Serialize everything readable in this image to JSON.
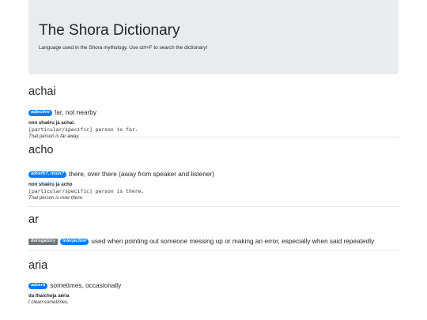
{
  "header": {
    "title": "The Shora Dictionary",
    "subtitle": "Language used in the Shora mythology. Use ctrl+F to search the dictionary!"
  },
  "entries": [
    {
      "word": "achai",
      "tags": [
        {
          "label": "adjective",
          "style": "blue"
        }
      ],
      "definition": "far, not nearby",
      "example": {
        "source": "non shaéru ja achai.",
        "gloss": "[particular/specific] person is far.",
        "translation": "That person is far away."
      }
    },
    {
      "word": "acho",
      "tags": [
        {
          "label": "adverb?, noun?",
          "style": "blue"
        }
      ],
      "definition": "there, over there (away from speaker and listener)",
      "example": {
        "source": "non shaéru ja acho",
        "gloss": "[particular/specific] person is there.",
        "translation": "That person is over there."
      }
    },
    {
      "word": "ar",
      "tags": [
        {
          "label": "derogatory",
          "style": "gray"
        },
        {
          "label": "interjection",
          "style": "blue"
        }
      ],
      "definition": "used when pointing out someone messing up or making an error, especially when said repeatedly"
    },
    {
      "word": "aria",
      "tags": [
        {
          "label": "adverb",
          "style": "blue"
        }
      ],
      "definition": "sometimes, occasionally",
      "example": {
        "source": "da thaichoja aéria",
        "translation": "I clean sometimes."
      }
    }
  ],
  "colors": {
    "header_bg": "#e9ecef",
    "badge_blue": "#007bff",
    "badge_gray": "#6c757d"
  }
}
